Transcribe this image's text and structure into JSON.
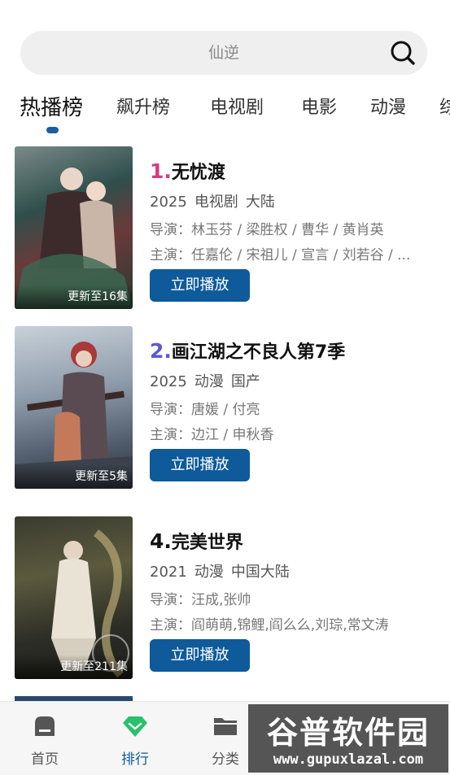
{
  "search": {
    "placeholder": "仙逆"
  },
  "tabs": [
    {
      "label": "热播榜",
      "active": true
    },
    {
      "label": "飙升榜"
    },
    {
      "label": "电视剧"
    },
    {
      "label": "电影"
    },
    {
      "label": "动漫"
    },
    {
      "label": "综"
    }
  ],
  "items": [
    {
      "rank": "1.",
      "rank_color": "#d63a7e",
      "title": "无忧渡",
      "year": "2025",
      "type": "电视剧",
      "region": "大陆",
      "director": "导演：林玉芬 / 梁胜权 / 曹华 / 黄肖英",
      "cast": "主演：任嘉伦 / 宋祖儿 / 宣言 / 刘若谷 / ...",
      "update": "更新至16集",
      "play_label": "立即播放"
    },
    {
      "rank": "2.",
      "rank_color": "#5a58d6",
      "title": "画江湖之不良人第7季",
      "year": "2025",
      "type": "动漫",
      "region": "国产",
      "director": "导演：唐媛 / 付亮",
      "cast": "主演：边江 / 申秋香",
      "update": "更新至5集",
      "play_label": "立即播放"
    },
    {
      "rank": "4.",
      "rank_color": "#111111",
      "title": "完美世界",
      "year": "2021",
      "type": "动漫",
      "region": "中国大陆",
      "director": "导演：汪成,张帅",
      "cast": "主演：阎萌萌,锦鲤,阎么么,刘琮,常文涛",
      "update": "更新至211集",
      "play_label": "立即播放"
    }
  ],
  "nav": [
    {
      "label": "首页",
      "icon": "home-icon"
    },
    {
      "label": "排行",
      "icon": "diamond-icon",
      "active": true
    },
    {
      "label": "分类",
      "icon": "folder-icon"
    }
  ],
  "watermark": {
    "line1": "谷普软件园",
    "line2": "www.gupuxlazal.com"
  },
  "colors": {
    "accent": "#0e5a9a",
    "active_tab_indicator": "#1b5fa3",
    "rank_nav_icon": "#27c26b"
  }
}
